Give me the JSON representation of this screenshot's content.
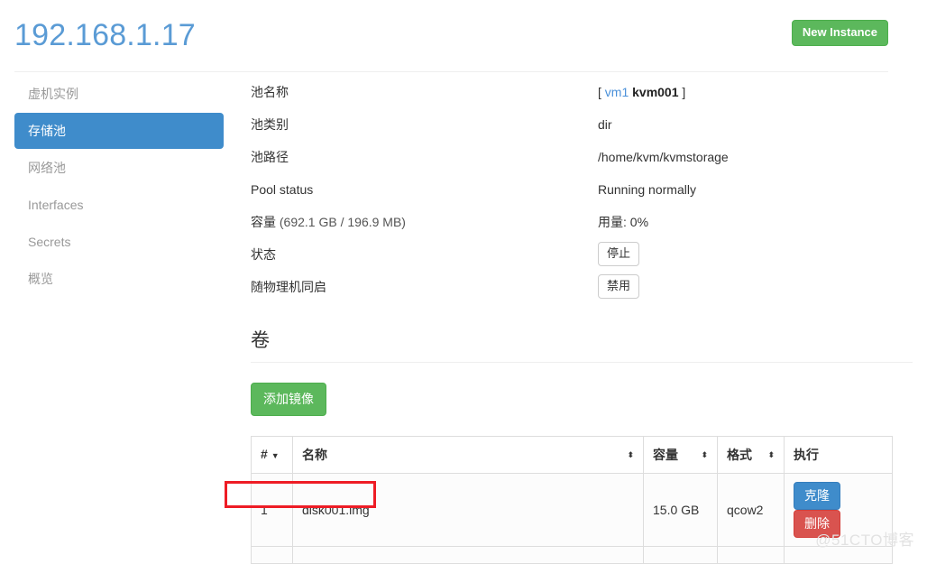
{
  "header": {
    "title": "192.168.1.17",
    "new_instance_label": "New Instance",
    "title_color": "#5a9bd5",
    "button_color": "#5cb85c"
  },
  "sidebar": {
    "items": [
      {
        "label": "虚机实例",
        "active": false
      },
      {
        "label": "存储池",
        "active": true
      },
      {
        "label": "网络池",
        "active": false
      },
      {
        "label": "Interfaces",
        "active": false
      },
      {
        "label": "Secrets",
        "active": false
      },
      {
        "label": "概览",
        "active": false
      }
    ],
    "active_color": "#3f8ccb"
  },
  "details": {
    "pool_name": {
      "label": "池名称",
      "bracket_open": "[",
      "link": "vm1",
      "name": "kvm001",
      "bracket_close": "]"
    },
    "pool_type": {
      "label": "池类别",
      "value": "dir"
    },
    "pool_path": {
      "label": "池路径",
      "value": "/home/kvm/kvmstorage"
    },
    "pool_status": {
      "label": "Pool status",
      "value": "Running normally"
    },
    "capacity": {
      "label_main": "容量",
      "label_sub": "(692.1 GB / 196.9 MB)",
      "total": "692.1 GB",
      "available": "196.9 MB",
      "usage_label": "用量:",
      "usage_value": "0%"
    },
    "state": {
      "label": "状态",
      "button": "停止"
    },
    "autostart": {
      "label": "随物理机同启",
      "button": "禁用"
    }
  },
  "volumes": {
    "section_title": "卷",
    "add_image_label": "添加镜像",
    "columns": [
      {
        "label": "#",
        "sort": "caret-down"
      },
      {
        "label": "名称",
        "sort": "sort-both"
      },
      {
        "label": "容量",
        "sort": "sort-both"
      },
      {
        "label": "格式",
        "sort": "sort-both"
      },
      {
        "label": "执行",
        "sort": ""
      }
    ],
    "rows": [
      {
        "index": "1",
        "name": "disk001.img",
        "size": "15.0 GB",
        "format": "qcow2",
        "clone_label": "克隆",
        "delete_label": "删除"
      }
    ],
    "clone_color": "#3f8ccb",
    "delete_color": "#d9534f"
  },
  "annotation": {
    "color": "#ee1c25"
  },
  "watermark": {
    "text": "@51CTO博客"
  }
}
